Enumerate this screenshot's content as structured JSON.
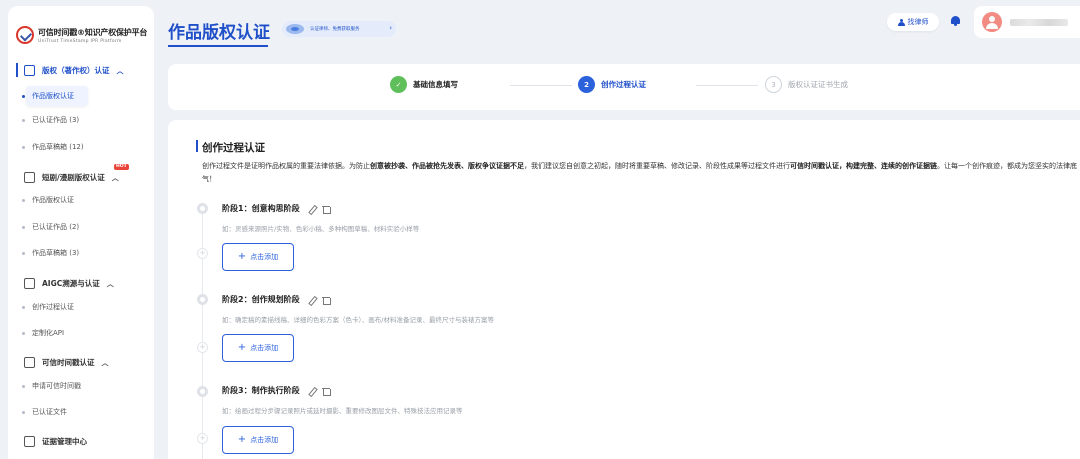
{
  "brand": {
    "title": "可信时间戳®知识产权保护平台",
    "subtitle": "UniTrust TimeStamp IPR Platform"
  },
  "sidebar": {
    "groups": [
      {
        "label": "版权（著作权）认证",
        "items": [
          "作品版权认证",
          "已认证作品 (3)",
          "作品草稿箱 (12)"
        ]
      },
      {
        "label": "短剧/漫剧版权认证",
        "badge": "HOT",
        "items": [
          "作品版权认证",
          "已认证作品 (2)",
          "作品草稿箱 (3)"
        ]
      },
      {
        "label": "AIGC溯源与认证",
        "items": [
          "创作过程认证",
          "定制化API"
        ]
      },
      {
        "label": "可信时间戳认证",
        "items": [
          "申请可信时间戳",
          "已认证文件"
        ]
      },
      {
        "label": "证据管理中心",
        "items": []
      }
    ]
  },
  "header": {
    "title": "作品版权认证",
    "promo_text": "认证律师、免费获取服务",
    "lawyer_button": "找律师"
  },
  "steps": [
    {
      "index": "✓",
      "label": "基础信息填写",
      "state": "done"
    },
    {
      "index": "2",
      "label": "创作过程认证",
      "state": "current"
    },
    {
      "index": "3",
      "label": "版权认证证书生成",
      "state": "pending"
    }
  ],
  "section": {
    "title": "创作过程认证",
    "desc_parts": [
      {
        "t": "创作过程文件是证明作品权属的重要法律依据。为防止",
        "b": false
      },
      {
        "t": "创意被抄袭、作品被抢先发表、版权争议证据不足",
        "b": true
      },
      {
        "t": "，我们建议您自创意之初起，随时将重要草稿、修改记录、阶段性成果等过程文件进行",
        "b": false
      },
      {
        "t": "可信时间戳认证",
        "b": true
      },
      {
        "t": "，构建完整、连续的创作证据链",
        "b": true
      },
      {
        "t": "。让每一个创作痕迹，都成为您坚实的法律底气！",
        "b": false
      }
    ]
  },
  "stages": [
    {
      "title": "阶段1：创意构思阶段",
      "hint": "如：灵感来源照片/实物、色彩小稿、多种构图草稿、材料实验小样等",
      "add_label": "点击添加"
    },
    {
      "title": "阶段2：创作规划阶段",
      "hint": "如：确定稿的素描线稿、详细的色彩方案（色卡）、画布/材料准备记录、最终尺寸与装裱方案等",
      "add_label": "点击添加"
    },
    {
      "title": "阶段3：制作执行阶段",
      "hint": "如：绘画过程分步骤记录照片或延时摄影、重要修改图层文件、特殊技法应用记录等",
      "add_label": "点击添加"
    }
  ],
  "colors": {
    "primary": "#2050c9",
    "success": "#5fbf5a",
    "hot": "#e8443a"
  }
}
